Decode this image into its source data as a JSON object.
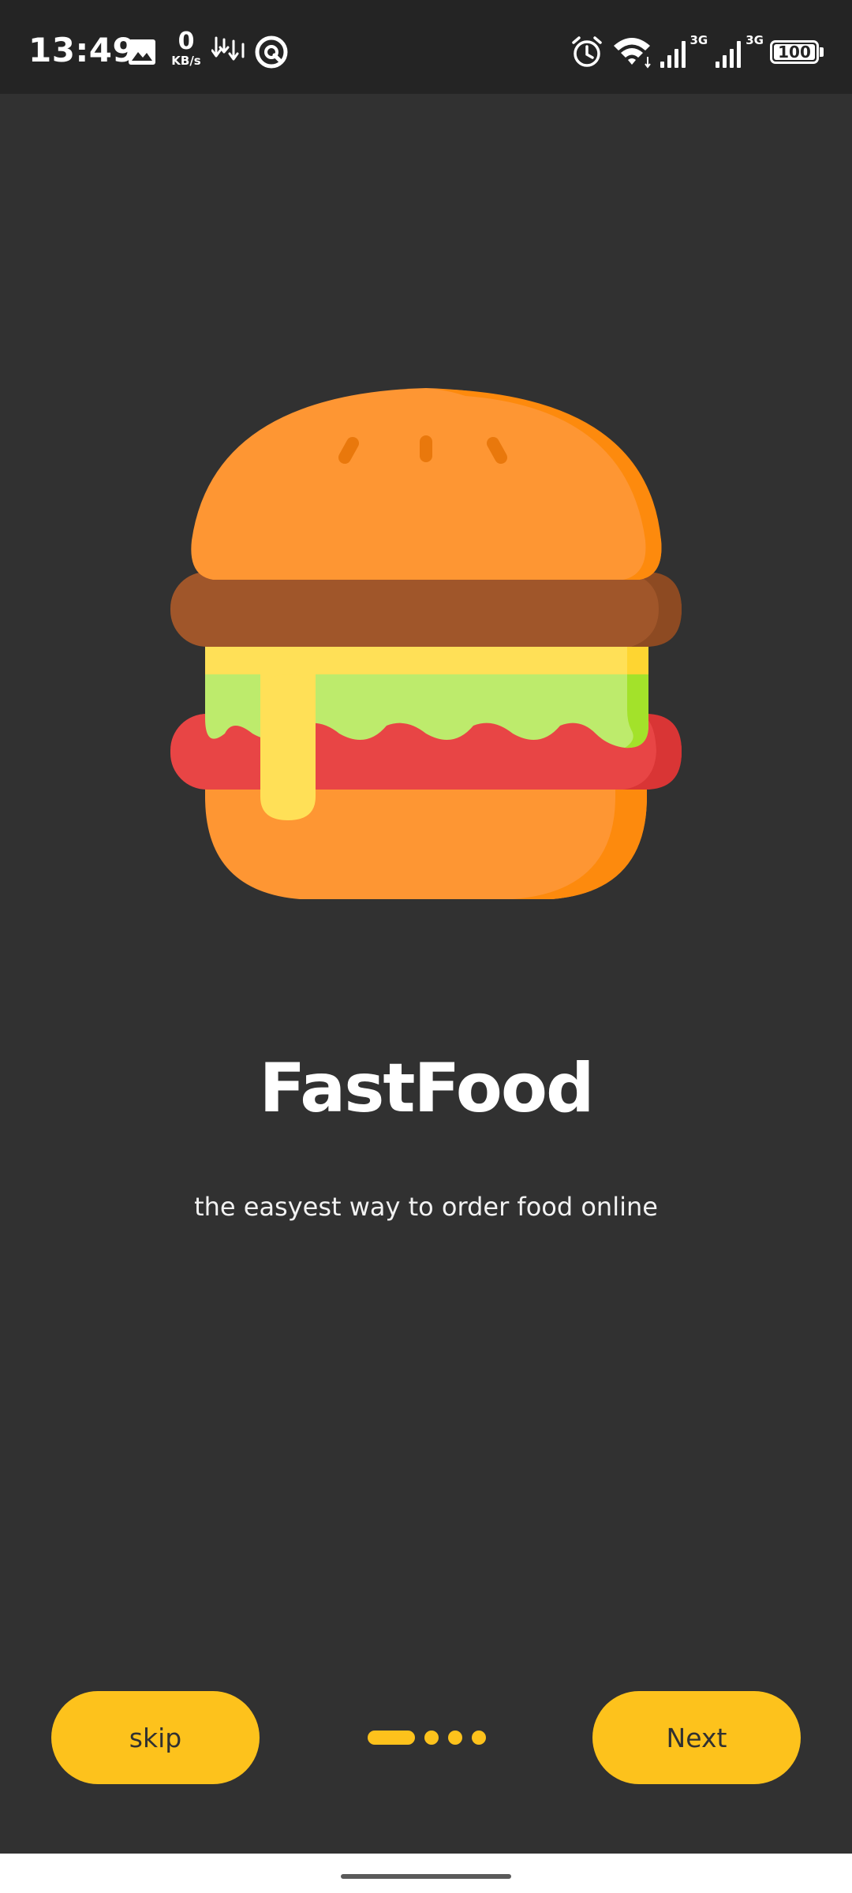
{
  "status_bar": {
    "time": "13:49",
    "net_speed_value": "0",
    "net_speed_unit": "KB/s",
    "signal1_label": "3G",
    "signal2_label": "3G",
    "battery": "100",
    "icons": [
      "image-icon",
      "data-transfer-icon",
      "app-notification-icon",
      "alarm-icon",
      "wifi-icon",
      "signal-icon",
      "signal-icon",
      "battery-icon"
    ]
  },
  "onboarding": {
    "illustration": "burger-icon",
    "title": "FastFood",
    "subtitle": "the easyest way to order food online",
    "page_indicator": {
      "total": 4,
      "current": 1
    }
  },
  "actions": {
    "skip_label": "skip",
    "next_label": "Next"
  },
  "colors": {
    "background": "#313131",
    "status_bar": "#242424",
    "accent": "#fdc21c",
    "text": "#ffffff"
  }
}
